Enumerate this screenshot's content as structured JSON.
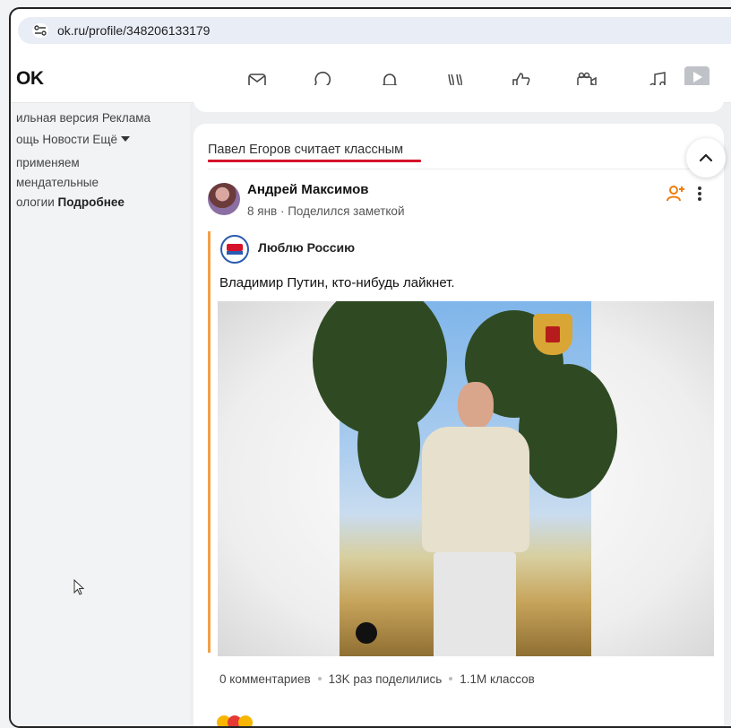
{
  "browser": {
    "url": "ok.ru/profile/348206133179"
  },
  "topnav": {
    "logo": "OK",
    "icons": [
      "mail-icon",
      "chat-icon",
      "bell-icon",
      "guests-icon",
      "like-icon",
      "video-camera-icon",
      "music-icon",
      "video-icon"
    ]
  },
  "sidebar": {
    "line1": "ильная версия  Реклама",
    "line2_text": "ощь  Новости  Ещё",
    "line3": "применяем",
    "line4": "мендательные",
    "line5_text": "ологии ",
    "line5_bold": "Подробнее"
  },
  "post": {
    "header": "Павел Егоров считает классным",
    "author": "Андрей Максимов",
    "meta": "8 янв · Поделился заметкой",
    "group_name": "Люблю Россию",
    "text": "Владимир Путин, кто-нибудь лайкнет.",
    "stats": {
      "comments": "0 комментариев",
      "shares": "13K раз поделились",
      "likes": "1.1M классов"
    }
  },
  "colors": {
    "accent_red": "#d6112a",
    "accent_orange": "#f1a14a"
  }
}
